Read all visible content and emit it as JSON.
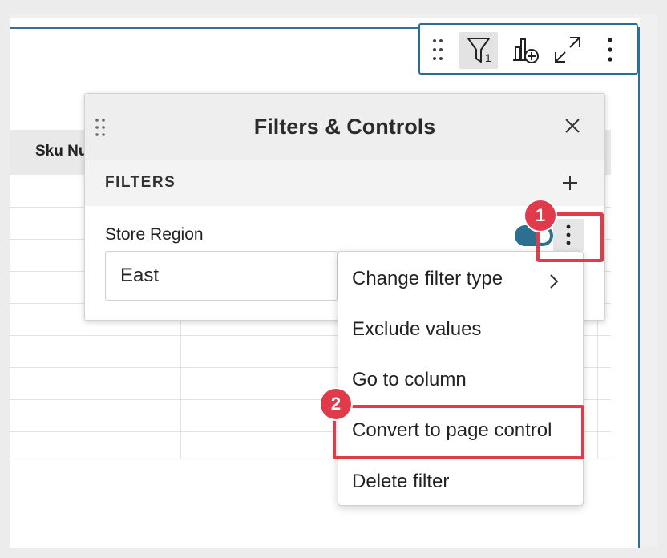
{
  "toolbar": {
    "filter_count": "1",
    "icons": [
      "drag-handle-icon",
      "filter-icon",
      "add-chart-icon",
      "expand-icon",
      "more-vertical-icon"
    ]
  },
  "table": {
    "column_header": "Sku Number"
  },
  "panel": {
    "title": "Filters & Controls",
    "section_label": "FILTERS",
    "filter": {
      "name": "Store Region",
      "value": "East",
      "enabled": true
    }
  },
  "menu": {
    "items": [
      {
        "label": "Change filter type",
        "has_submenu": true
      },
      {
        "label": "Exclude values"
      },
      {
        "label": "Go to column"
      },
      {
        "label": "Convert to page control"
      },
      {
        "label": "Delete filter"
      }
    ]
  },
  "annotations": {
    "step1": "1",
    "step2": "2",
    "highlight_color": "#e03a4b"
  },
  "colors": {
    "accent": "#2c6f91"
  }
}
